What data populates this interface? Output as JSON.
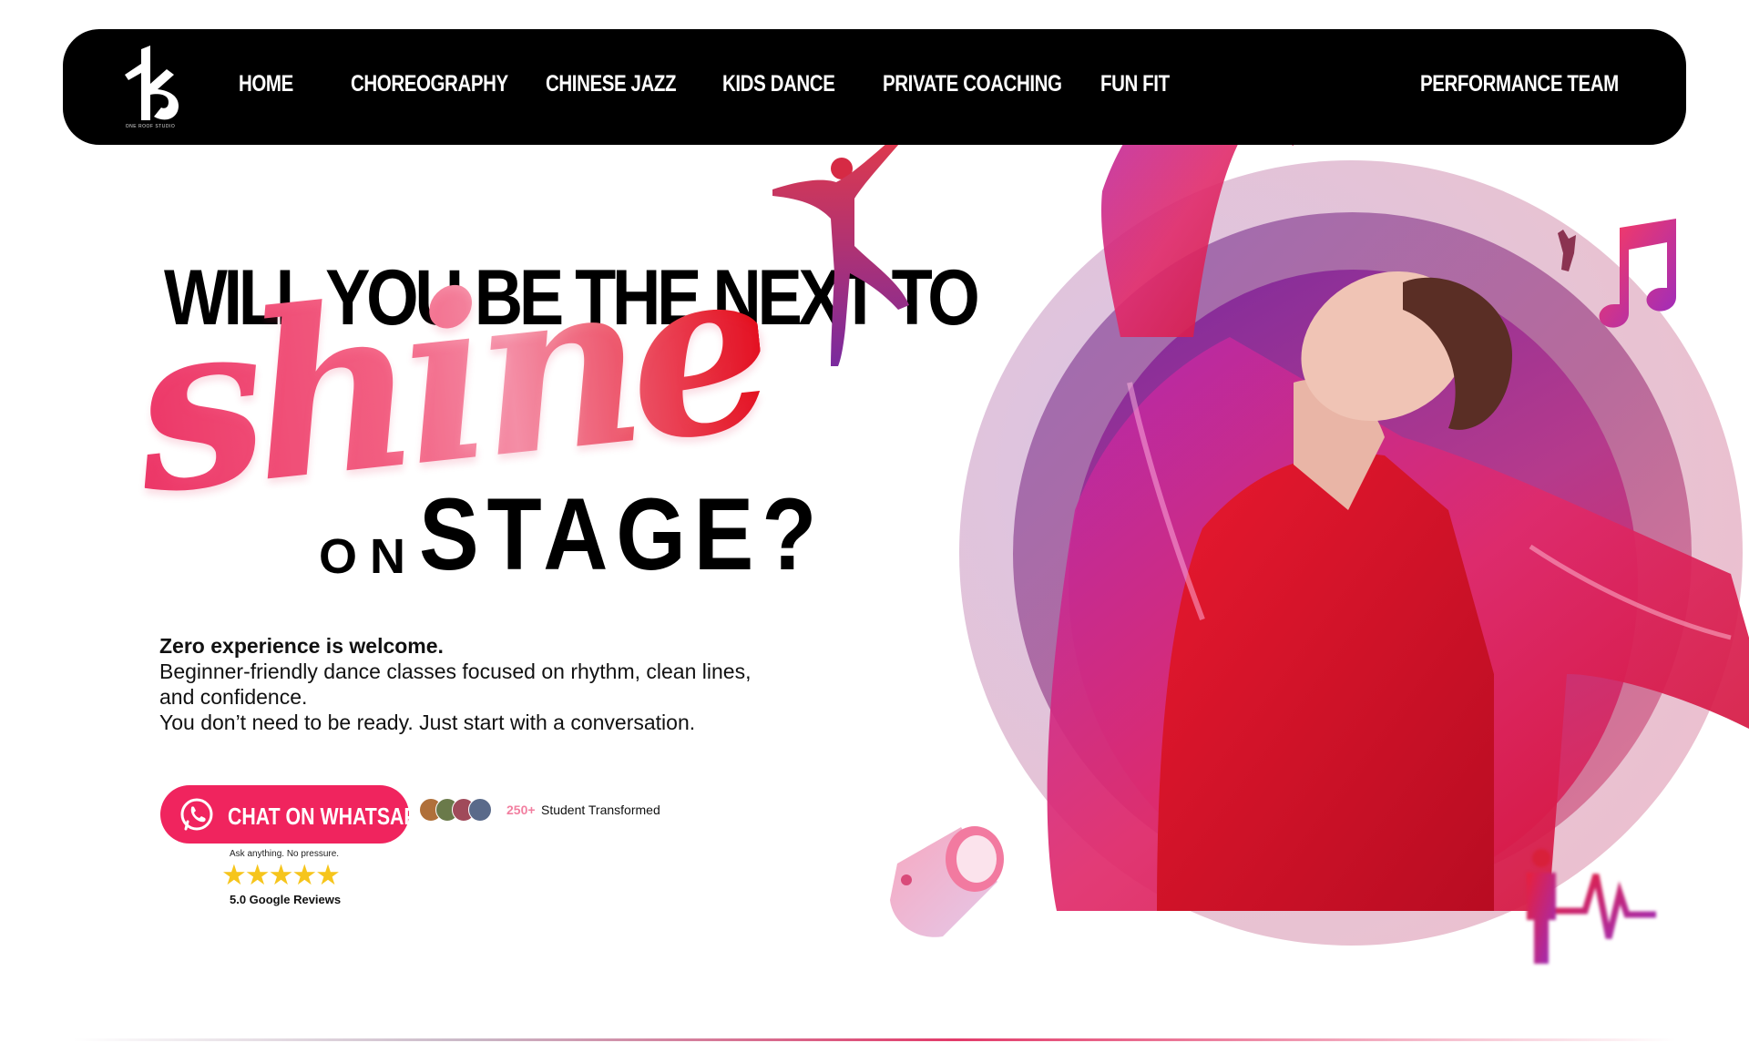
{
  "brand": {
    "logo_icon": "k-monogram-logo",
    "caption": "ONE ROOF STUDIO"
  },
  "nav": {
    "items": [
      {
        "label": "HOME"
      },
      {
        "label": "CHOREOGRAPHY"
      },
      {
        "label": "CHINESE JAZZ"
      },
      {
        "label": "KIDS DANCE"
      },
      {
        "label": "PRIVATE COACHING"
      },
      {
        "label": "FUN FIT"
      },
      {
        "label": "PERFORMANCE TEAM"
      }
    ]
  },
  "hero": {
    "headline_top": "WILL YOU BE THE NEXT TO",
    "headline_script": "shine",
    "headline_on": "ON",
    "headline_stage": "STAGE?",
    "copy": {
      "strong": "Zero experience is welcome.",
      "line1": "Beginner-friendly dance classes focused on rhythm, clean lines, and confidence.",
      "line2": "You don’t need to be ready. Just start with a conversation."
    },
    "cta": {
      "label": "CHAT ON WHATSAPP",
      "icon": "whatsapp-icon",
      "note": "Ask anything. No pressure."
    },
    "social_proof": {
      "count": "250+",
      "label": "Student Transformed",
      "rating_stars": 5,
      "stars_text": "★★★★★",
      "reviews": "5.0 Google Reviews"
    }
  },
  "colors": {
    "accent": "#f0245e",
    "nav_bg": "#000000",
    "star": "#f6c51c",
    "script_start": "#ee3a6b",
    "script_end": "#e40e1a"
  },
  "decor": {
    "photo": "male-dancer-red-jacket-photo",
    "figure": "red-dancer-figurine-icon",
    "music": "music-notes-icon",
    "speaker": "pink-speaker-icon",
    "heartbeat": "person-heartbeat-icon"
  }
}
